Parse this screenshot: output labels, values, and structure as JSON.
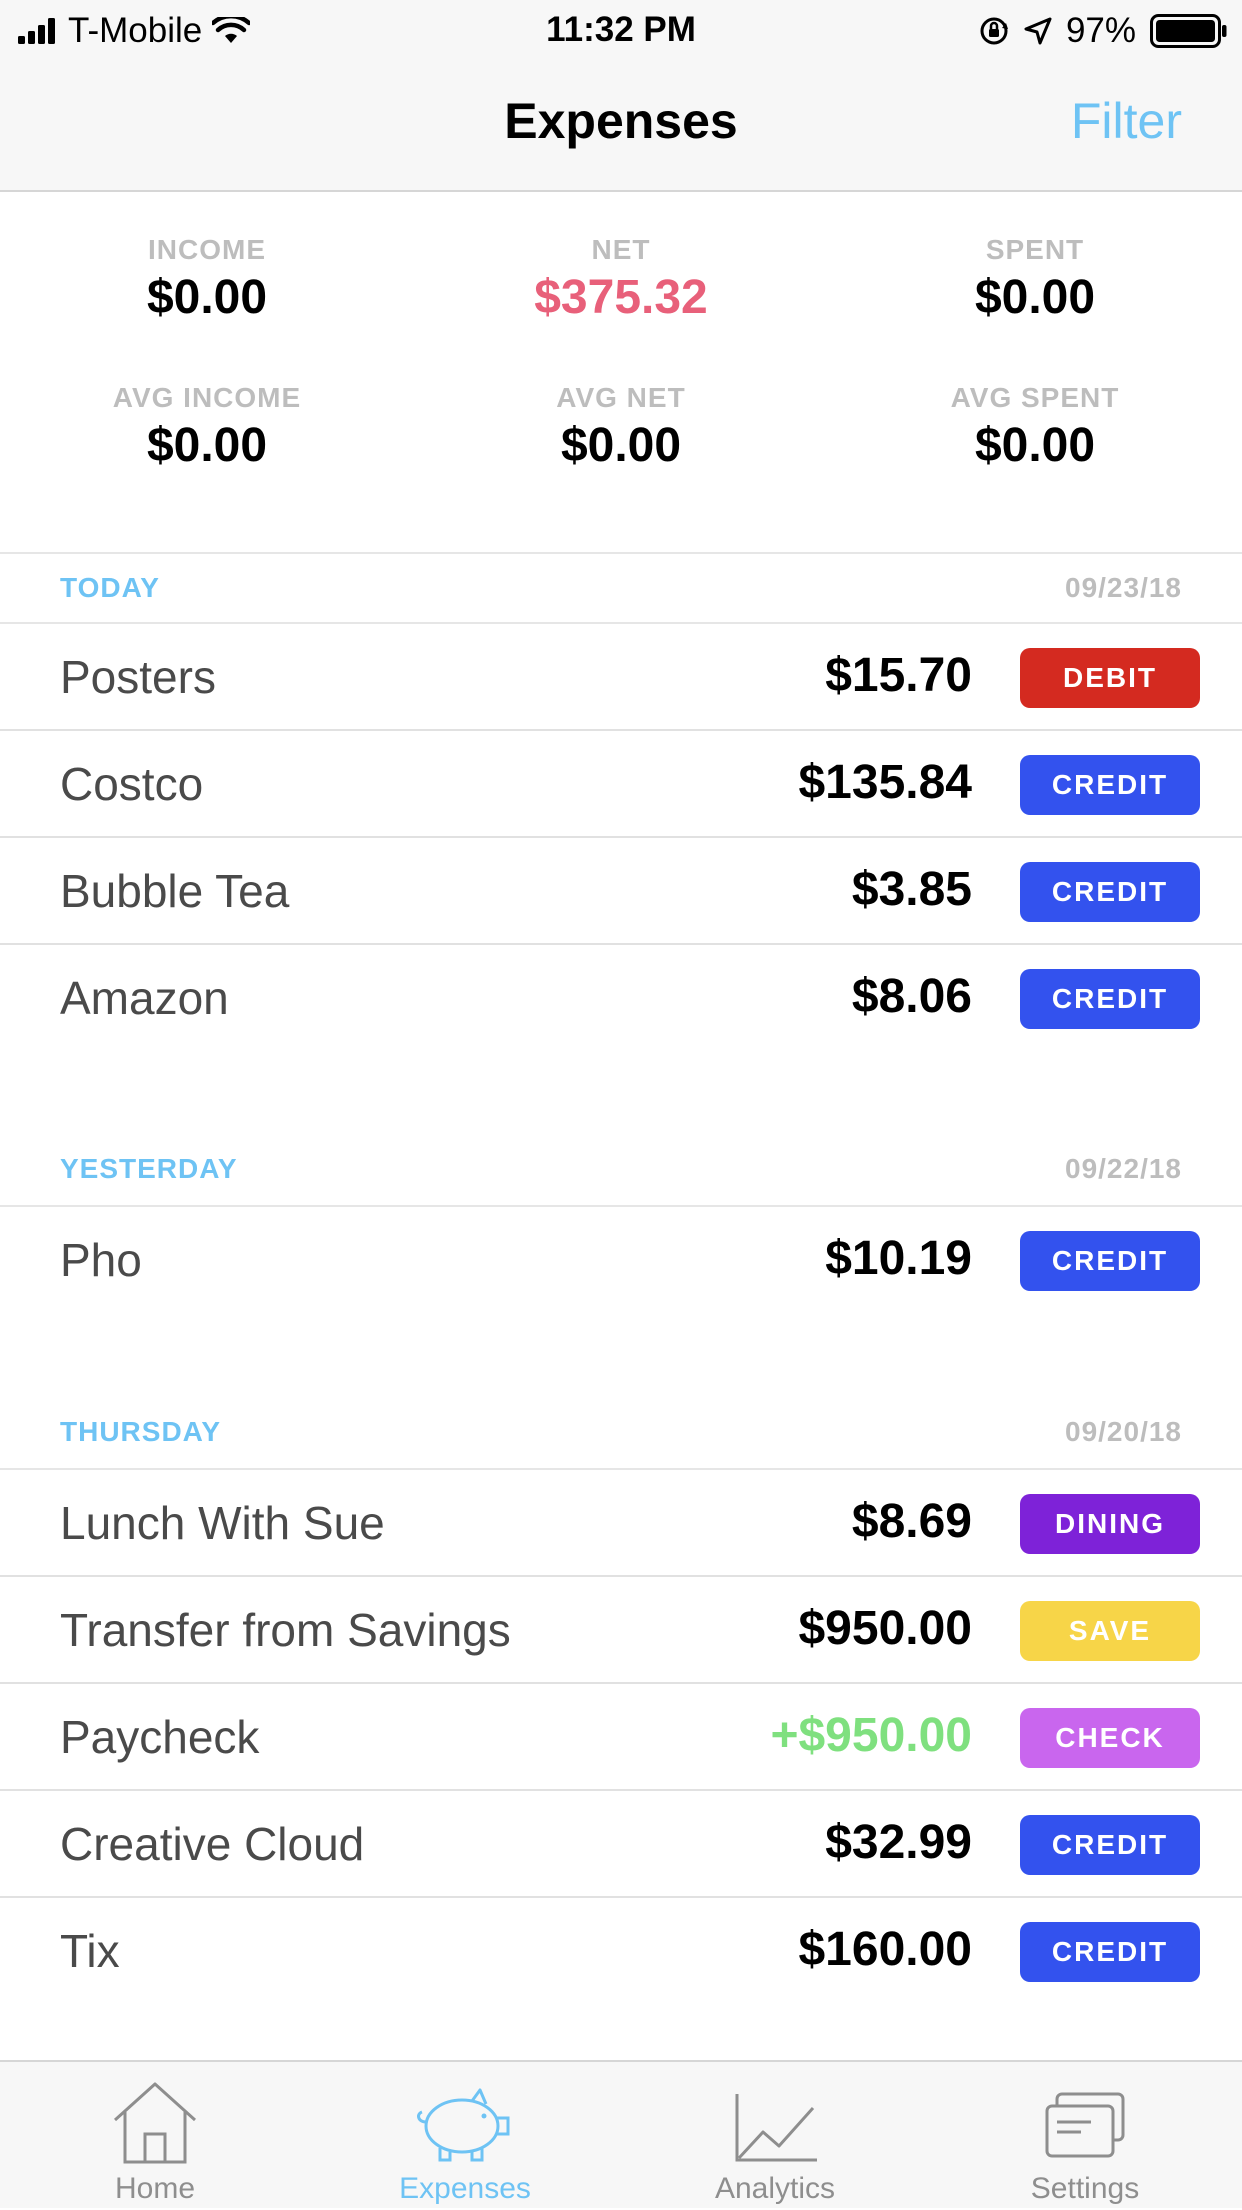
{
  "status_bar": {
    "carrier": "T-Mobile",
    "time": "11:32 PM",
    "battery": "97%"
  },
  "nav": {
    "title": "Expenses",
    "filter_label": "Filter"
  },
  "summary": {
    "income_label": "INCOME",
    "income_value": "$0.00",
    "net_label": "NET",
    "net_value": "$375.32",
    "spent_label": "SPENT",
    "spent_value": "$0.00",
    "avg_income_label": "AVG INCOME",
    "avg_income_value": "$0.00",
    "avg_net_label": "AVG NET",
    "avg_net_value": "$0.00",
    "avg_spent_label": "AVG SPENT",
    "avg_spent_value": "$0.00",
    "net_color": "#e8607a"
  },
  "sections": [
    {
      "name": "TODAY",
      "date": "09/23/18",
      "rows": [
        {
          "name": "Posters",
          "amount": "$15.70",
          "tag": "DEBIT"
        },
        {
          "name": "Costco",
          "amount": "$135.84",
          "tag": "CREDIT"
        },
        {
          "name": "Bubble Tea",
          "amount": "$3.85",
          "tag": "CREDIT"
        },
        {
          "name": "Amazon",
          "amount": "$8.06",
          "tag": "CREDIT"
        }
      ]
    },
    {
      "name": "YESTERDAY",
      "date": "09/22/18",
      "rows": [
        {
          "name": "Pho",
          "amount": "$10.19",
          "tag": "CREDIT"
        }
      ]
    },
    {
      "name": "THURSDAY",
      "date": "09/20/18",
      "rows": [
        {
          "name": "Lunch With Sue",
          "amount": "$8.69",
          "tag": "DINING"
        },
        {
          "name": "Transfer from Savings",
          "amount": "$950.00",
          "tag": "SAVE"
        },
        {
          "name": "Paycheck",
          "amount": "+$950.00",
          "tag": "CHECK"
        },
        {
          "name": "Creative Cloud",
          "amount": "$32.99",
          "tag": "CREDIT"
        },
        {
          "name": "Tix",
          "amount": "$160.00",
          "tag": "CREDIT"
        }
      ]
    }
  ],
  "tag_colors": {
    "DEBIT": "#d42a20",
    "CREDIT": "#3352ee",
    "DINING": "#7e22d8",
    "SAVE": "#f7d548",
    "CHECK": "#c966ee"
  },
  "colors": {
    "accent": "#6ec3f4",
    "income": "#7fe07f"
  },
  "tab_bar": {
    "tabs": [
      {
        "label": "Home",
        "icon": "house-icon"
      },
      {
        "label": "Expenses",
        "icon": "piggy-bank-icon",
        "active": true
      },
      {
        "label": "Analytics",
        "icon": "line-chart-icon"
      },
      {
        "label": "Settings",
        "icon": "cards-icon"
      }
    ]
  }
}
